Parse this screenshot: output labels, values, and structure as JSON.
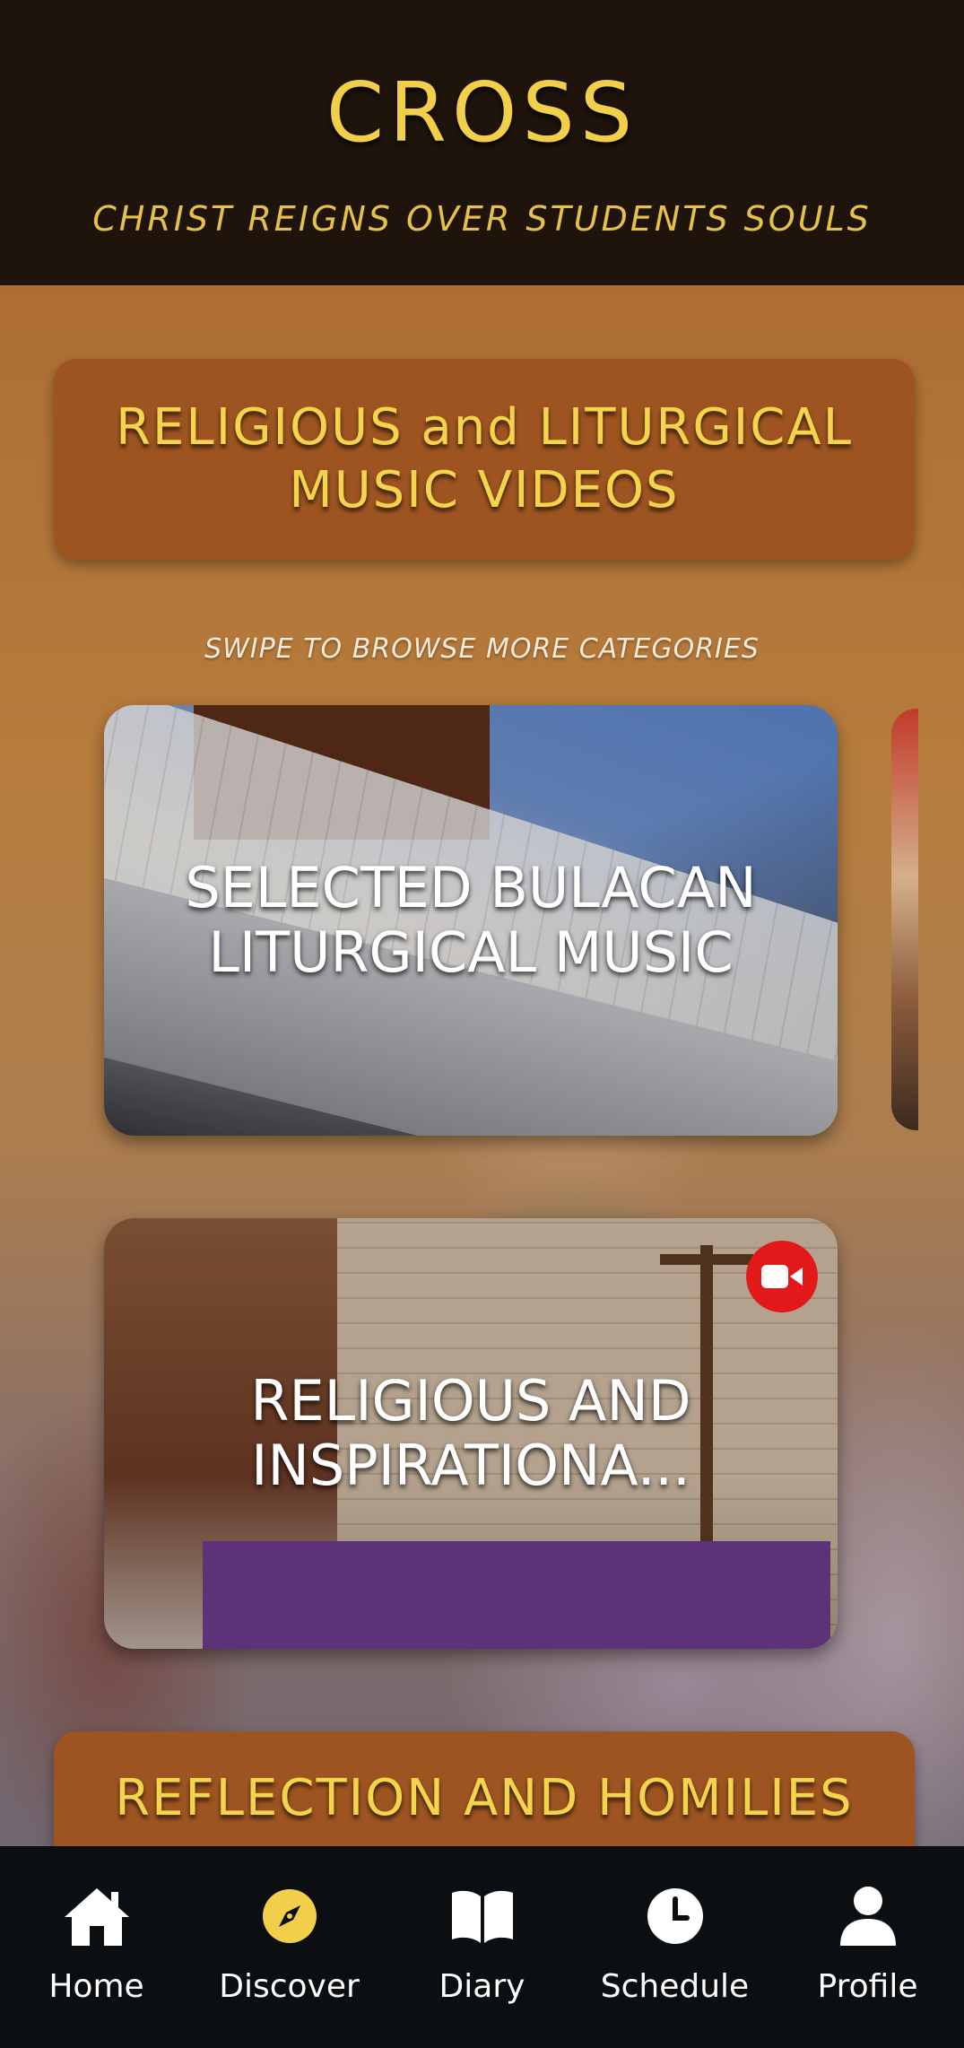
{
  "header": {
    "title": "CROSS",
    "subtitle": "CHRIST REIGNS OVER STUDENTS SOULS"
  },
  "sections": [
    {
      "title": "RELIGIOUS and LITURGICAL MUSIC VIDEOS"
    },
    {
      "title": "REFLECTION AND HOMILIES"
    }
  ],
  "swipe_hint": "SWIPE TO BROWSE MORE CATEGORIES",
  "cards": [
    {
      "title": "SELECTED BULACAN LITURGICAL MUSIC",
      "live": false
    },
    {
      "title": "RELIGIOUS AND INSPIRATIONA...",
      "live": true,
      "badge_icon": "video-camera-icon"
    }
  ],
  "bottom_nav": {
    "items": [
      {
        "label": "Home",
        "icon": "home-icon",
        "active": false
      },
      {
        "label": "Discover",
        "icon": "compass-icon",
        "active": true
      },
      {
        "label": "Diary",
        "icon": "book-icon",
        "active": false
      },
      {
        "label": "Schedule",
        "icon": "clock-icon",
        "active": false
      },
      {
        "label": "Profile",
        "icon": "person-icon",
        "active": false
      }
    ]
  },
  "colors": {
    "accent_gold": "#f2cf4a",
    "banner_brown": "#9d5420",
    "header_bg": "#1e140c",
    "nav_bg": "#0b0f12",
    "badge_red": "#e3181b"
  }
}
